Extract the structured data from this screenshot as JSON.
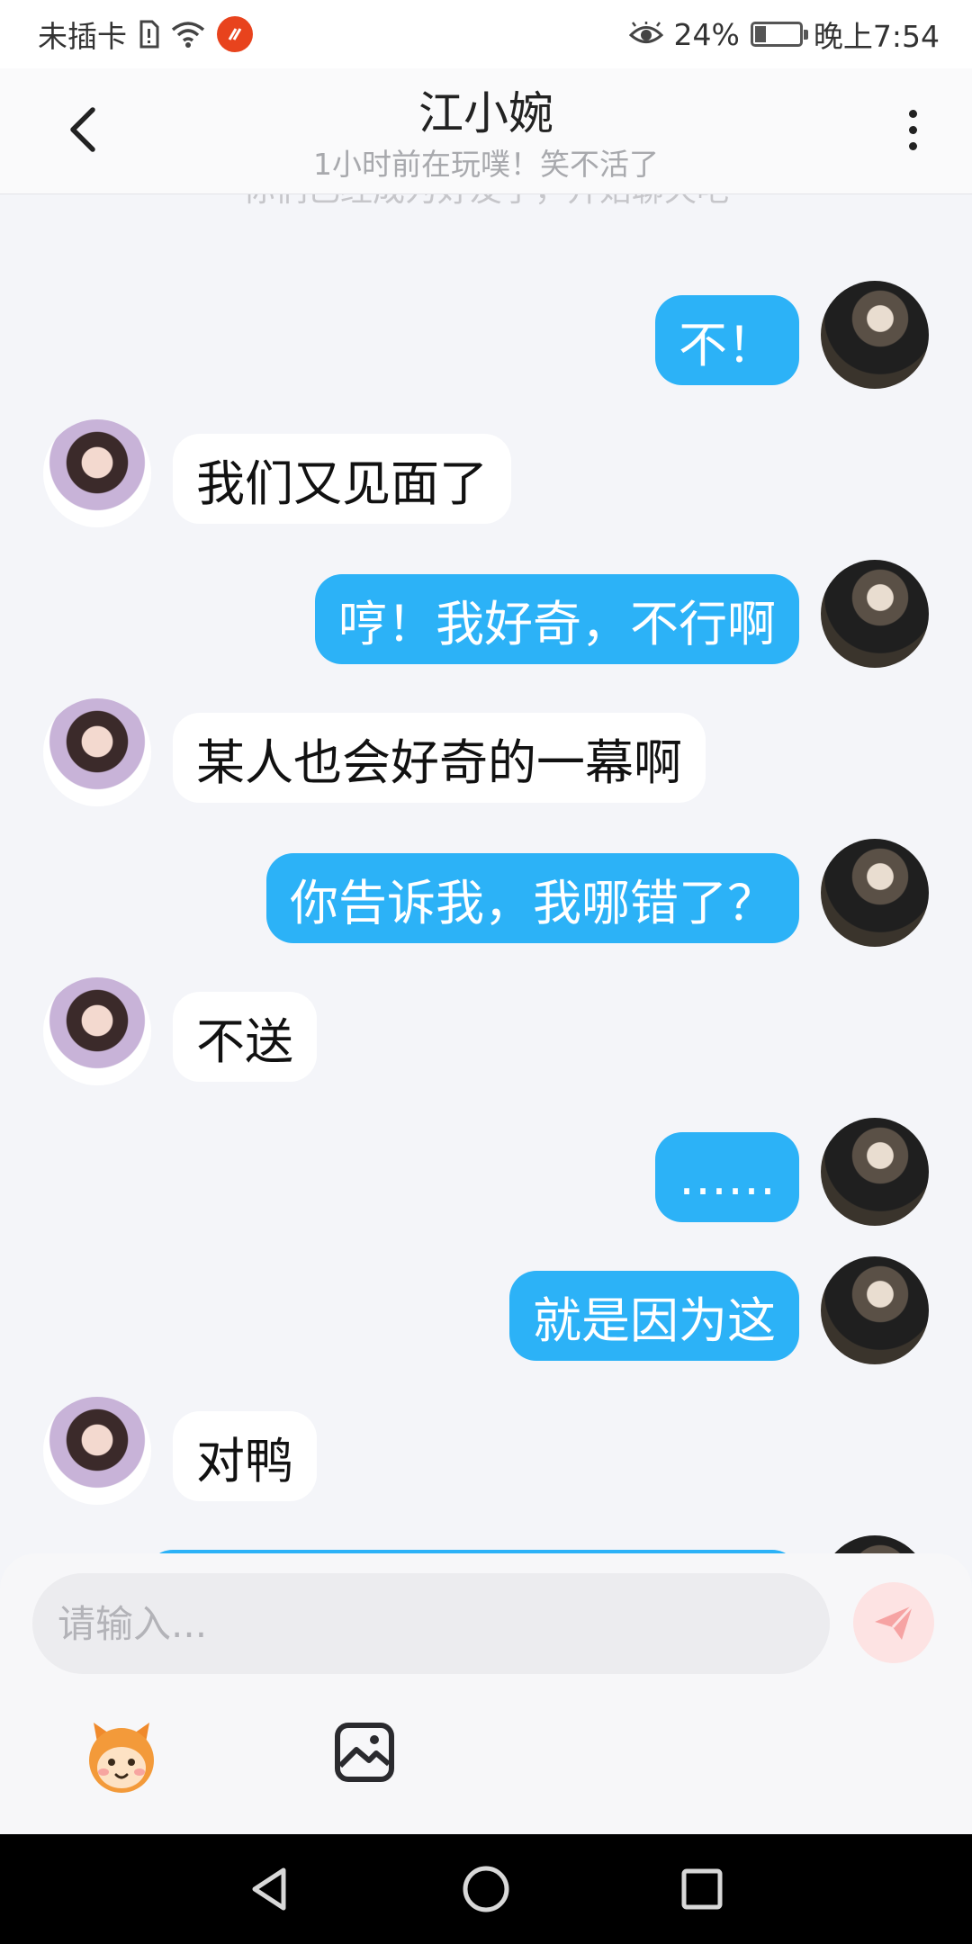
{
  "status_bar": {
    "carrier": "未插卡",
    "battery_percent": "24%",
    "battery_level": 0.24,
    "time": "晚上7:54"
  },
  "header": {
    "contact_name": "江小婉",
    "contact_status": "1小时前在玩噗！笑不活了"
  },
  "chat": {
    "system_note": "你们已经成为好友了，开始聊天吧",
    "messages": [
      {
        "sender": "self",
        "text": "不！"
      },
      {
        "sender": "other",
        "text": "我们又见面了"
      },
      {
        "sender": "self",
        "text": "哼！我好奇，不行啊"
      },
      {
        "sender": "other",
        "text": "某人也会好奇的一幕啊"
      },
      {
        "sender": "self",
        "text": "你告诉我，我哪错了？"
      },
      {
        "sender": "other",
        "text": "不送"
      },
      {
        "sender": "self",
        "text": "……"
      },
      {
        "sender": "self",
        "text": "就是因为这"
      },
      {
        "sender": "other",
        "text": "对鸭"
      },
      {
        "sender": "self",
        "text": ""
      }
    ]
  },
  "composer": {
    "placeholder": "请输入...",
    "value": ""
  },
  "colors": {
    "self_bubble": "#2cb2f7",
    "other_bubble": "#ffffff",
    "send_button": "#fde3e3",
    "send_icon": "#f6a3a3",
    "background": "#f4f5f9"
  },
  "icons": {
    "back": "chevron-left-icon",
    "more": "more-vertical-icon",
    "send": "send-icon",
    "mascot": "mascot-emoji-icon",
    "image": "image-icon",
    "nav_back": "triangle-back-icon",
    "nav_home": "circle-home-icon",
    "nav_recent": "square-recent-icon"
  }
}
